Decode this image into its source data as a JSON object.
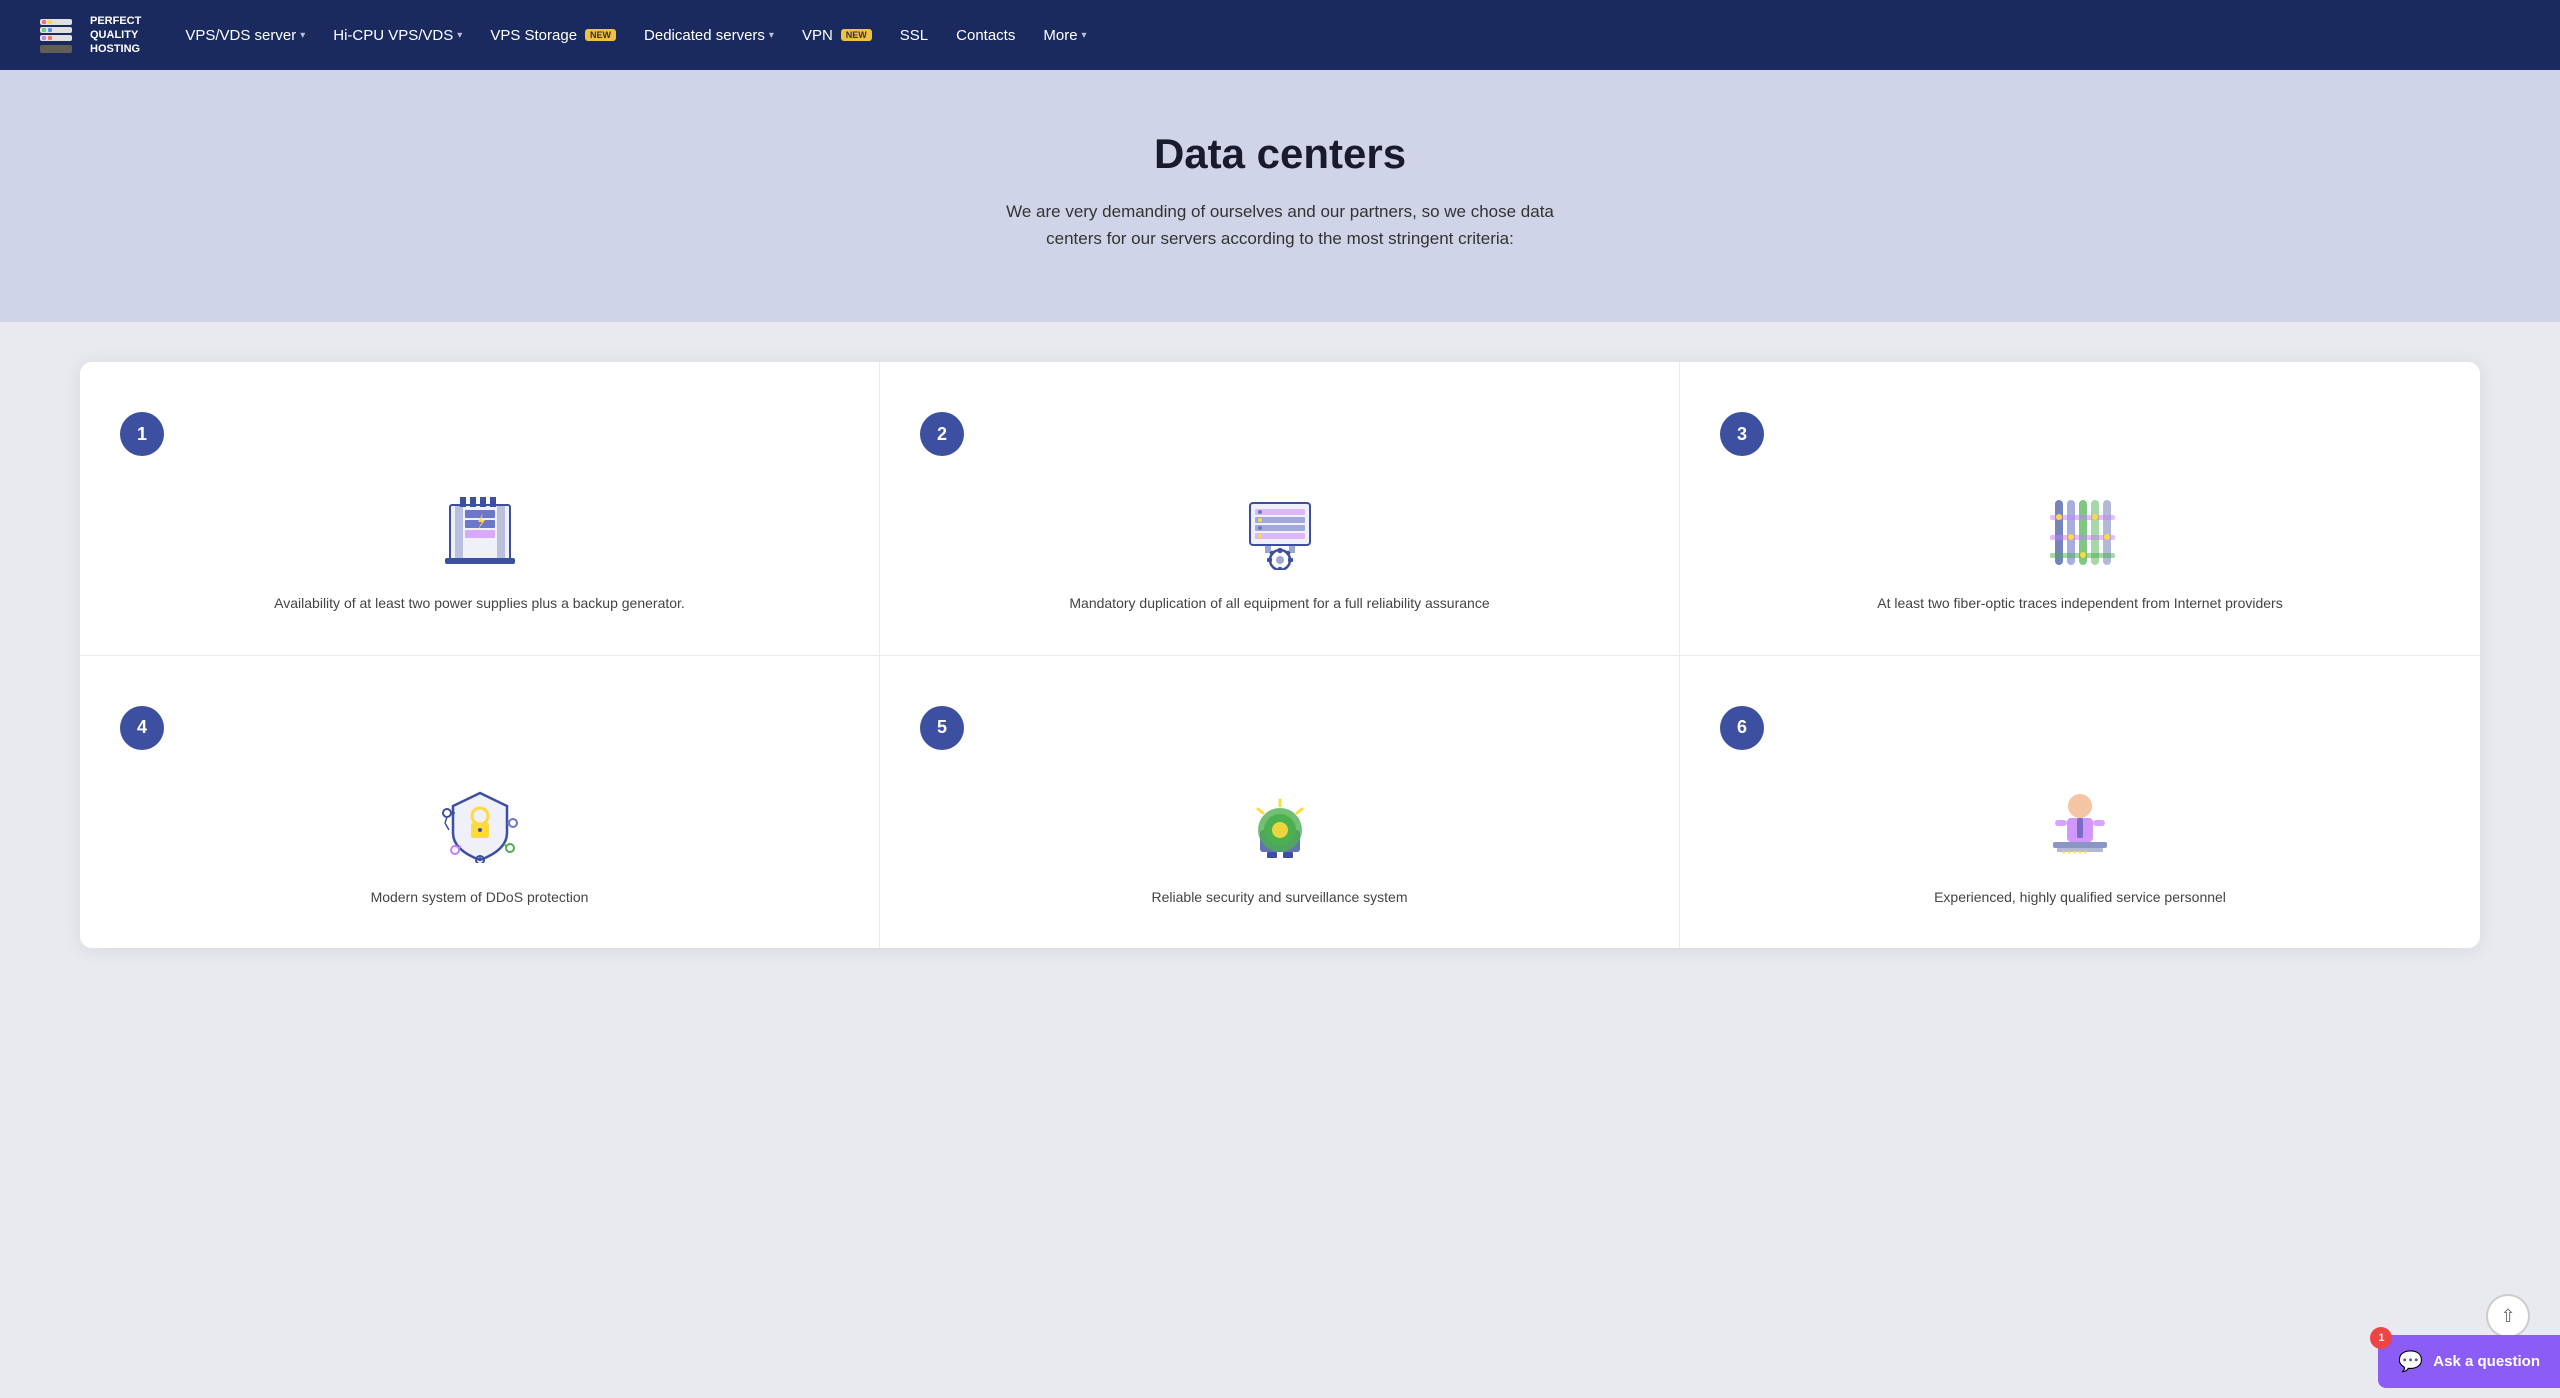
{
  "navbar": {
    "logo_text": "PERFECT\nQUALITY\nHOSTING",
    "items": [
      {
        "label": "VPS/VDS server",
        "has_dropdown": true,
        "badge": null
      },
      {
        "label": "Hi-CPU VPS/VDS",
        "has_dropdown": true,
        "badge": null
      },
      {
        "label": "VPS Storage",
        "has_dropdown": false,
        "badge": "NEW"
      },
      {
        "label": "Dedicated servers",
        "has_dropdown": true,
        "badge": null
      },
      {
        "label": "VPN",
        "has_dropdown": false,
        "badge": "NEW"
      },
      {
        "label": "SSL",
        "has_dropdown": false,
        "badge": null
      },
      {
        "label": "Contacts",
        "has_dropdown": false,
        "badge": null
      },
      {
        "label": "More",
        "has_dropdown": true,
        "badge": null
      }
    ]
  },
  "hero": {
    "title": "Data centers",
    "subtitle": "We are very demanding of ourselves and our partners, so we chose data centers for our servers according to the most stringent criteria:"
  },
  "cards": [
    {
      "number": "1",
      "text": "Availability of at least two power supplies plus a backup generator."
    },
    {
      "number": "2",
      "text": "Mandatory duplication of all equipment for a full reliability assurance"
    },
    {
      "number": "3",
      "text": "At least two fiber-optic traces independent from Internet providers"
    },
    {
      "number": "4",
      "text": "Modern system of DDoS protection"
    },
    {
      "number": "5",
      "text": "Reliable security and surveillance system"
    },
    {
      "number": "6",
      "text": "Experienced, highly qualified service personnel"
    }
  ],
  "ask_button": {
    "label": "Ask a question",
    "badge": "1"
  }
}
